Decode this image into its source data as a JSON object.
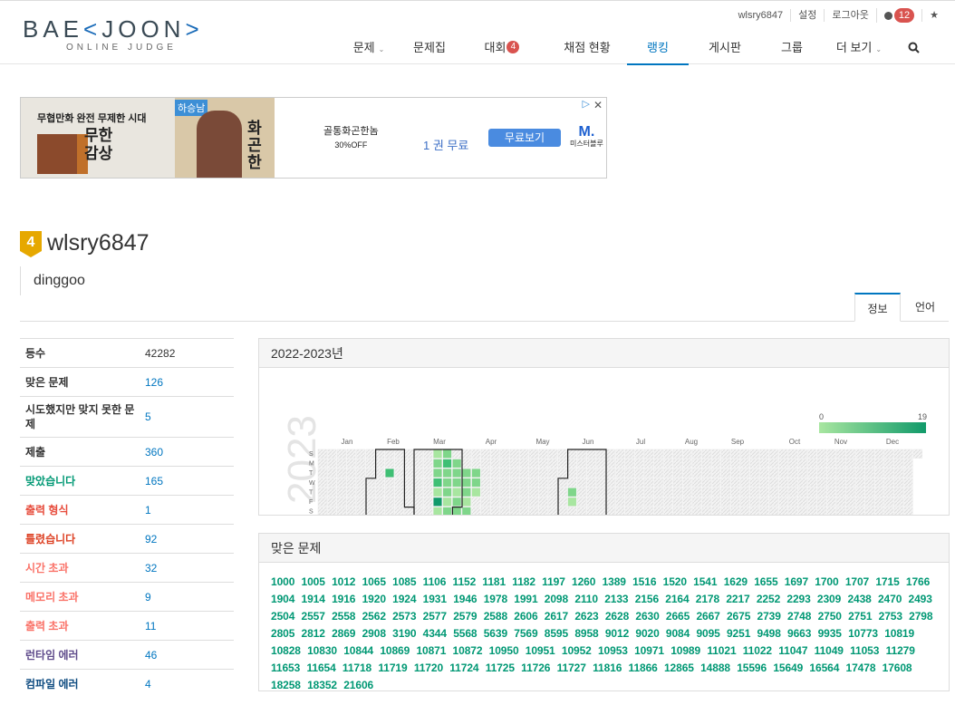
{
  "brand": {
    "logo_text_a": "BAE",
    "logo_bracket_l": "<",
    "logo_text_b": "JOON",
    "logo_bracket_r": ">",
    "logo_sub": "ONLINE JUDGE"
  },
  "usermenu": {
    "username": "wlsry6847",
    "settings": "설정",
    "logout": "로그아웃",
    "notif_count": "12",
    "star": "★"
  },
  "nav": [
    {
      "label": "문제",
      "caret": "⌄"
    },
    {
      "label": "문제집"
    },
    {
      "label": "대회",
      "count": "4"
    },
    {
      "label": "채점 현황"
    },
    {
      "label": "랭킹"
    },
    {
      "label": "게시판"
    },
    {
      "label": "그룹"
    },
    {
      "label": "더 보기",
      "caret": "⌄"
    }
  ],
  "ad": {
    "left_line": "무협만화 완전 무제한 시대",
    "left_hl": "완전 무제한",
    "left_title": "무한 감상",
    "mid_tag": "하승남",
    "mid_title": "화곤한",
    "text1": "골통화곤한놈",
    "text2": "30%OFF",
    "free": "1 권 무료",
    "button": "무료보기",
    "brand": "미스터블루",
    "brand_mark": "M."
  },
  "profile": {
    "rank_num": "4",
    "username": "wlsry6847",
    "status_message": "dinggoo"
  },
  "tabs": {
    "info": "정보",
    "lang": "언어"
  },
  "stats": [
    {
      "key": "등수",
      "value": "42282",
      "color": "#333333",
      "value_color": "#333333"
    },
    {
      "key": "맞은 문제",
      "value": "126",
      "color": "#333333"
    },
    {
      "key": "시도했지만 맞지 못한 문제",
      "value": "5",
      "color": "#333333"
    },
    {
      "key": "제출",
      "value": "360",
      "color": "#333333"
    },
    {
      "key": "맞았습니다",
      "value": "165",
      "color": "#009874"
    },
    {
      "key": "출력 형식",
      "value": "1",
      "color": "#e74c3c"
    },
    {
      "key": "틀렸습니다",
      "value": "92",
      "color": "#dd4124"
    },
    {
      "key": "시간 초과",
      "value": "32",
      "color": "#fa7268"
    },
    {
      "key": "메모리 초과",
      "value": "9",
      "color": "#fa7268"
    },
    {
      "key": "출력 초과",
      "value": "11",
      "color": "#fa7268"
    },
    {
      "key": "런타임 에러",
      "value": "46",
      "color": "#5f4b8b"
    },
    {
      "key": "컴파일 에러",
      "value": "4",
      "color": "#0f4c81"
    }
  ],
  "heatmap": {
    "title": "2022-2023년",
    "year_watermark": "2023",
    "legend_min": "0",
    "legend_max": "19",
    "months": [
      "Jan",
      "Feb",
      "Mar",
      "Apr",
      "May",
      "Jun",
      "Jul",
      "Aug",
      "Sep",
      "Oct",
      "Nov",
      "Dec"
    ],
    "weekdays": [
      "S",
      "M",
      "T",
      "W",
      "T",
      "F",
      "S"
    ],
    "colors": {
      "empty": "#ebebeb",
      "l1": "#a8e6a0",
      "l2": "#7fd68a",
      "l3": "#3fbf74",
      "l4": "#119a6a"
    }
  },
  "solved": {
    "title": "맞은 문제",
    "ids": [
      "1000",
      "1005",
      "1012",
      "1065",
      "1085",
      "1106",
      "1152",
      "1181",
      "1182",
      "1197",
      "1260",
      "1389",
      "1516",
      "1520",
      "1541",
      "1629",
      "1655",
      "1697",
      "1700",
      "1707",
      "1715",
      "1766",
      "1904",
      "1914",
      "1916",
      "1920",
      "1924",
      "1931",
      "1946",
      "1978",
      "1991",
      "2098",
      "2110",
      "2133",
      "2156",
      "2164",
      "2178",
      "2217",
      "2252",
      "2293",
      "2309",
      "2438",
      "2470",
      "2493",
      "2504",
      "2557",
      "2558",
      "2562",
      "2573",
      "2577",
      "2579",
      "2588",
      "2606",
      "2617",
      "2623",
      "2628",
      "2630",
      "2665",
      "2667",
      "2675",
      "2739",
      "2748",
      "2750",
      "2751",
      "2753",
      "2798",
      "2805",
      "2812",
      "2869",
      "2908",
      "3190",
      "4344",
      "5568",
      "5639",
      "7569",
      "8595",
      "8958",
      "9012",
      "9020",
      "9084",
      "9095",
      "9251",
      "9498",
      "9663",
      "9935",
      "10773",
      "10819",
      "10828",
      "10830",
      "10844",
      "10869",
      "10871",
      "10872",
      "10950",
      "10951",
      "10952",
      "10953",
      "10971",
      "10989",
      "11021",
      "11022",
      "11047",
      "11049",
      "11053",
      "11279",
      "11653",
      "11654",
      "11718",
      "11719",
      "11720",
      "11724",
      "11725",
      "11726",
      "11727",
      "11816",
      "11866",
      "12865",
      "14888",
      "15596",
      "15649",
      "16564",
      "17478",
      "17608",
      "18258",
      "18352",
      "21606"
    ]
  }
}
